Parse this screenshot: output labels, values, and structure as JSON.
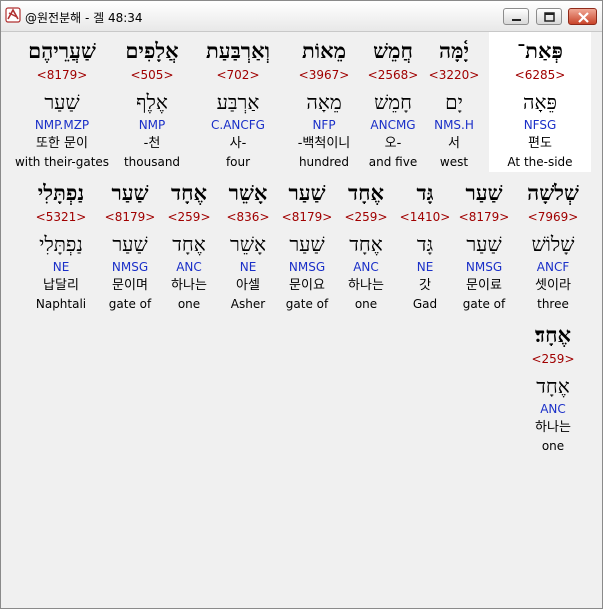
{
  "window": {
    "title": "@원전분해 - 겔 48:34",
    "icons": {
      "app": "app-logo-icon",
      "minimize": "minimize-icon",
      "maximize": "maximize-icon",
      "close": "close-icon"
    }
  },
  "verse": {
    "rows": [
      [
        {
          "heb": "פְּאַת־",
          "num": "<6285>",
          "root": "פֵּאָה",
          "morph": "NFSG",
          "ko": "편도",
          "en": "At the-side"
        },
        {
          "heb": "יָ֫מָּה",
          "num": "<3220>",
          "root": "יָם",
          "morph": "NMS.H",
          "ko": "서",
          "en": "west"
        },
        {
          "heb": "חֲמֵשׁ",
          "num": "<2568>",
          "root": "חָמֵשׁ",
          "morph": "ANCMG",
          "ko": "오-",
          "en": "and five"
        },
        {
          "heb": "מֵאוֹת",
          "num": "<3967>",
          "root": "מֵאָה",
          "morph": "NFP",
          "ko": "-백척이니",
          "en": "hundred"
        },
        {
          "heb": "וְאַרְבַּעַת",
          "num": "<702>",
          "root": "אַרְבַּע",
          "morph": "C.ANCFG",
          "ko": "사-",
          "en": "four"
        },
        {
          "heb": "אֲלָפִים",
          "num": "<505>",
          "root": "אֶלֶף",
          "morph": "NMP",
          "ko": "-천",
          "en": "thousand"
        },
        {
          "heb": "שַׁעֲרֵיהֶם",
          "num": "<8179>",
          "root": "שַׁעַר",
          "morph": "NMP.MZP",
          "ko": "또한 문이",
          "en": "with their-gates"
        }
      ],
      [
        {
          "heb": "שְׁלֹשָׁה",
          "num": "<7969>",
          "root": "שָׁלוֹשׁ",
          "morph": "ANCF",
          "ko": "셋이라",
          "en": "three"
        },
        {
          "heb": "שַׁעַר",
          "num": "<8179>",
          "root": "שַׁעַר",
          "morph": "NMSG",
          "ko": "문이료",
          "en": "gate of"
        },
        {
          "heb": "גָּד",
          "num": "<1410>",
          "root": "גָּד",
          "morph": "NE",
          "ko": "갓",
          "en": "Gad"
        },
        {
          "heb": "אֶחָד",
          "num": "<259>",
          "root": "אֶחָד",
          "morph": "ANC",
          "ko": "하나는",
          "en": "one"
        },
        {
          "heb": "שַׁעַר",
          "num": "<8179>",
          "root": "שַׁעַר",
          "morph": "NMSG",
          "ko": "문이요",
          "en": "gate of"
        },
        {
          "heb": "אָשֵׁר",
          "num": "<836>",
          "root": "אָשֵׁר",
          "morph": "NE",
          "ko": "아셀",
          "en": "Asher"
        },
        {
          "heb": "אֶחָד",
          "num": "<259>",
          "root": "אֶחָד",
          "morph": "ANC",
          "ko": "하나는",
          "en": "one"
        },
        {
          "heb": "שַׁעַר",
          "num": "<8179>",
          "root": "שַׁעַר",
          "morph": "NMSG",
          "ko": "문이며",
          "en": "gate of"
        },
        {
          "heb": "נַפְתָּלִי",
          "num": "<5321>",
          "root": "נַפְתָּלִי",
          "morph": "NE",
          "ko": "납달리",
          "en": "Naphtali"
        }
      ],
      [
        {
          "heb": "אֶחָד׃",
          "num": "<259>",
          "root": "אֶחָד",
          "morph": "ANC",
          "ko": "하나는",
          "en": "one"
        }
      ]
    ]
  }
}
